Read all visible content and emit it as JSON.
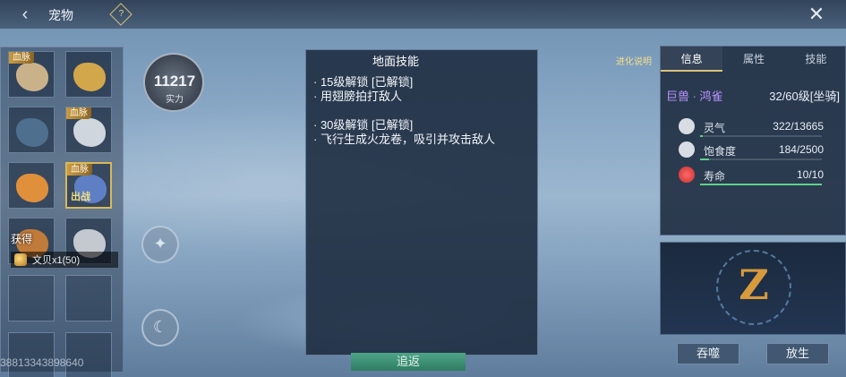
{
  "header": {
    "title": "宠物",
    "help_badge": "?"
  },
  "pet_list": {
    "blood_tag": "血脉",
    "fight_tag": "出战",
    "slots": [
      {
        "has_blood_tag": true,
        "color": "#c9b28a"
      },
      {
        "has_blood_tag": false,
        "color": "#d2a64a"
      },
      {
        "has_blood_tag": false,
        "color": "#4f6f8f"
      },
      {
        "has_blood_tag": true,
        "color": "#cfd6de"
      },
      {
        "has_blood_tag": false,
        "color": "#e0903a"
      },
      {
        "has_blood_tag": true,
        "color": "#5f7fc5"
      },
      {
        "has_blood_tag": false,
        "color": "#c07a3a"
      },
      {
        "has_blood_tag": false,
        "color": "#c4c8cf"
      }
    ]
  },
  "reward": {
    "label": "获得",
    "item": "文贝x1(50)"
  },
  "uid_text": "38813343898640",
  "power": {
    "value": "11217",
    "label": "实力"
  },
  "tooltip": {
    "title": "地面技能",
    "lines": [
      "· 15级解锁  [已解锁]",
      "· 用翅膀拍打敌人",
      "· 30级解锁  [已解锁]",
      "· 飞行生成火龙卷，吸引并攻击敌人"
    ]
  },
  "return_button": "追返",
  "evolve_label": "进化说明",
  "info": {
    "tabs": [
      "信息",
      "属性",
      "技能"
    ],
    "name": "巨兽 · 鸿雀",
    "level": "32/60级[坐骑]",
    "stats": [
      {
        "label": "灵气",
        "value": "322/13665",
        "ratio": 0.0236
      },
      {
        "label": "饱食度",
        "value": "184/2500",
        "ratio": 0.0736
      },
      {
        "label": "寿命",
        "value": "10/10",
        "ratio": 1.0
      }
    ]
  },
  "buttons": {
    "devour": "吞噬",
    "release": "放生"
  },
  "colors": {
    "accent_gold": "#d9c27a",
    "name_purple": "#b893ff",
    "bar_green": "#5fd08a"
  }
}
